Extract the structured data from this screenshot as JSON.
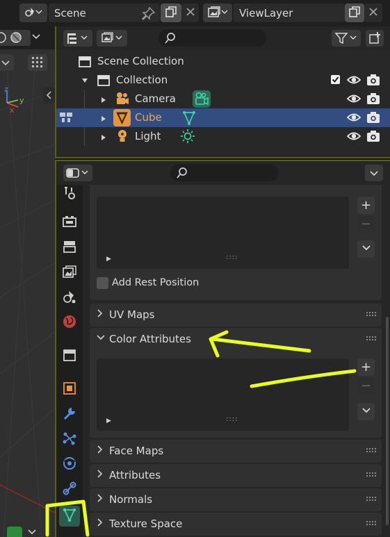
{
  "header": {
    "scene_label": "Scene",
    "viewlayer_label": "ViewLayer"
  },
  "outliner": {
    "search_placeholder": "",
    "rows": [
      {
        "label": "Scene Collection"
      },
      {
        "label": "Collection"
      },
      {
        "label": "Camera"
      },
      {
        "label": "Cube"
      },
      {
        "label": "Light"
      }
    ]
  },
  "properties": {
    "search_placeholder": "",
    "add_rest_position_label": "Add Rest Position",
    "panels": {
      "uv_maps": "UV Maps",
      "color_attributes": "Color Attributes",
      "face_maps": "Face Maps",
      "attributes": "Attributes",
      "normals": "Normals",
      "texture_space": "Texture Space"
    },
    "list_footer_grip": "::::",
    "add_symbol": "+",
    "remove_symbol": "−"
  },
  "colors": {
    "accent_selected_row": "#334d80",
    "active_object_text": "#f0a84a",
    "data_icon_green": "#3cd6a6",
    "annotation_yellow": "#e8ff1c"
  },
  "icons": [
    "scene-icon",
    "pin-icon",
    "new-scene-icon",
    "close-icon",
    "viewlayer-icon",
    "filter-icon",
    "new-collection-icon",
    "search-icon",
    "eye-icon",
    "camera-render-icon",
    "checkbox-icon"
  ]
}
